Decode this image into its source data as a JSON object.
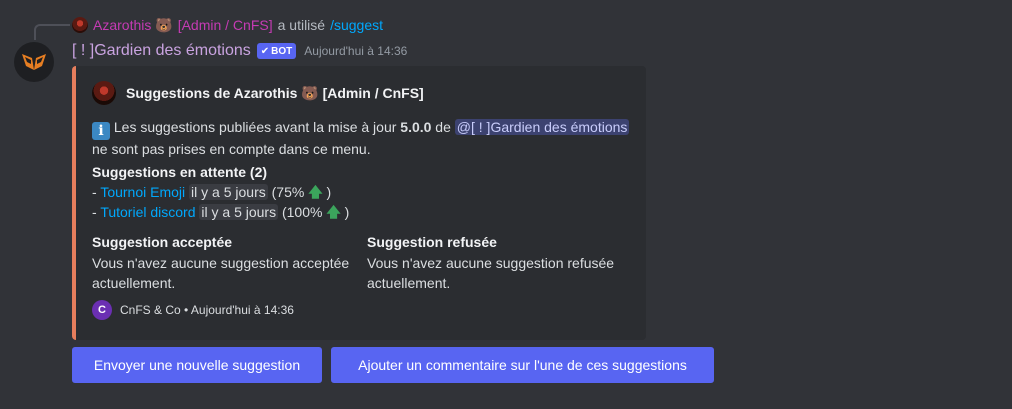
{
  "reply": {
    "user_name": "Azarothis 🐻",
    "user_role": "[Admin / CnFS]",
    "used_text": "a utilisé",
    "command": "/suggest"
  },
  "message": {
    "bot_name": "[ ! ]Gardien des émotions",
    "bot_tag": "BOT",
    "timestamp": "Aujourd'hui à 14:36"
  },
  "embed": {
    "accent_color": "#e67e5d",
    "author": "Suggestions de Azarothis 🐻 [Admin / CnFS]",
    "description": {
      "icon_text": "i",
      "text_before": " Les suggestions publiées avant la mise à jour ",
      "version": "5.0.0",
      "text_mid": " de ",
      "mention": "@[ ! ]Gardien des émotions",
      "text_after": "ne sont pas prises en compte dans ce menu."
    },
    "pending": {
      "title": "Suggestions en attente (2)",
      "items": [
        {
          "prefix": "- ",
          "name": "Tournoi Emoji",
          "time": "il y a 5 jours",
          "stat_open": " (75% ",
          "stat_close": " )"
        },
        {
          "prefix": "- ",
          "name": "Tutoriel discord",
          "time": "il y a 5 jours",
          "stat_open": " (100% ",
          "stat_close": " )"
        }
      ]
    },
    "accepted": {
      "title": "Suggestion acceptée",
      "body": "Vous n'avez aucune suggestion acceptée actuellement."
    },
    "refused": {
      "title": "Suggestion refusée",
      "body": "Vous n'avez aucune suggestion refusée actuellement."
    },
    "footer": {
      "icon_text": "C",
      "text": "CnFS & Co • Aujourd'hui à 14:36"
    }
  },
  "buttons": {
    "new_suggestion": "Envoyer une nouvelle suggestion",
    "add_comment": "Ajouter un commentaire sur l'une de ces suggestions"
  },
  "colors": {
    "background": "#313338",
    "embed_bg": "#2b2d31",
    "button": "#5865f2",
    "link": "#00a8fc",
    "bot_name": "#c9a3e0",
    "user_name": "#c53bb4"
  }
}
